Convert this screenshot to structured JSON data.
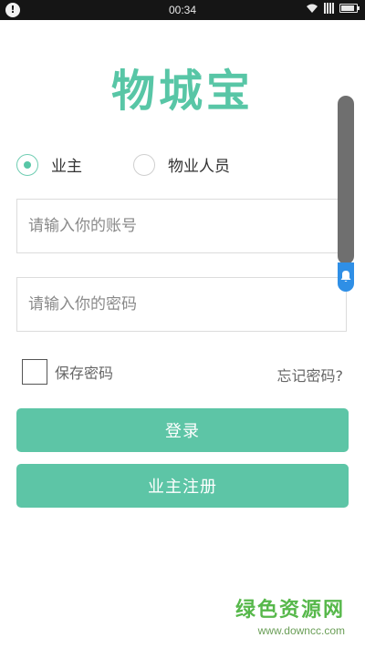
{
  "status_bar": {
    "time": "00:34",
    "notification_badge": "!"
  },
  "app": {
    "logo_text": "物城宝",
    "brand_color": "#58c6a6"
  },
  "role_selector": {
    "options": [
      {
        "label": "业主",
        "selected": true
      },
      {
        "label": "物业人员",
        "selected": false
      }
    ]
  },
  "login_form": {
    "account_placeholder": "请输入你的账号",
    "account_value": "",
    "password_placeholder": "请输入你的密码",
    "password_value": "",
    "remember_label": "保存密码",
    "remember_checked": false,
    "forgot_label": "忘记密码?"
  },
  "buttons": {
    "login": "登录",
    "register": "业主注册",
    "color": "#5dc5a6"
  },
  "overlay": {
    "icon": "bell-icon"
  },
  "watermark": {
    "title": "绿色资源网",
    "url": "www.downcc.com"
  }
}
